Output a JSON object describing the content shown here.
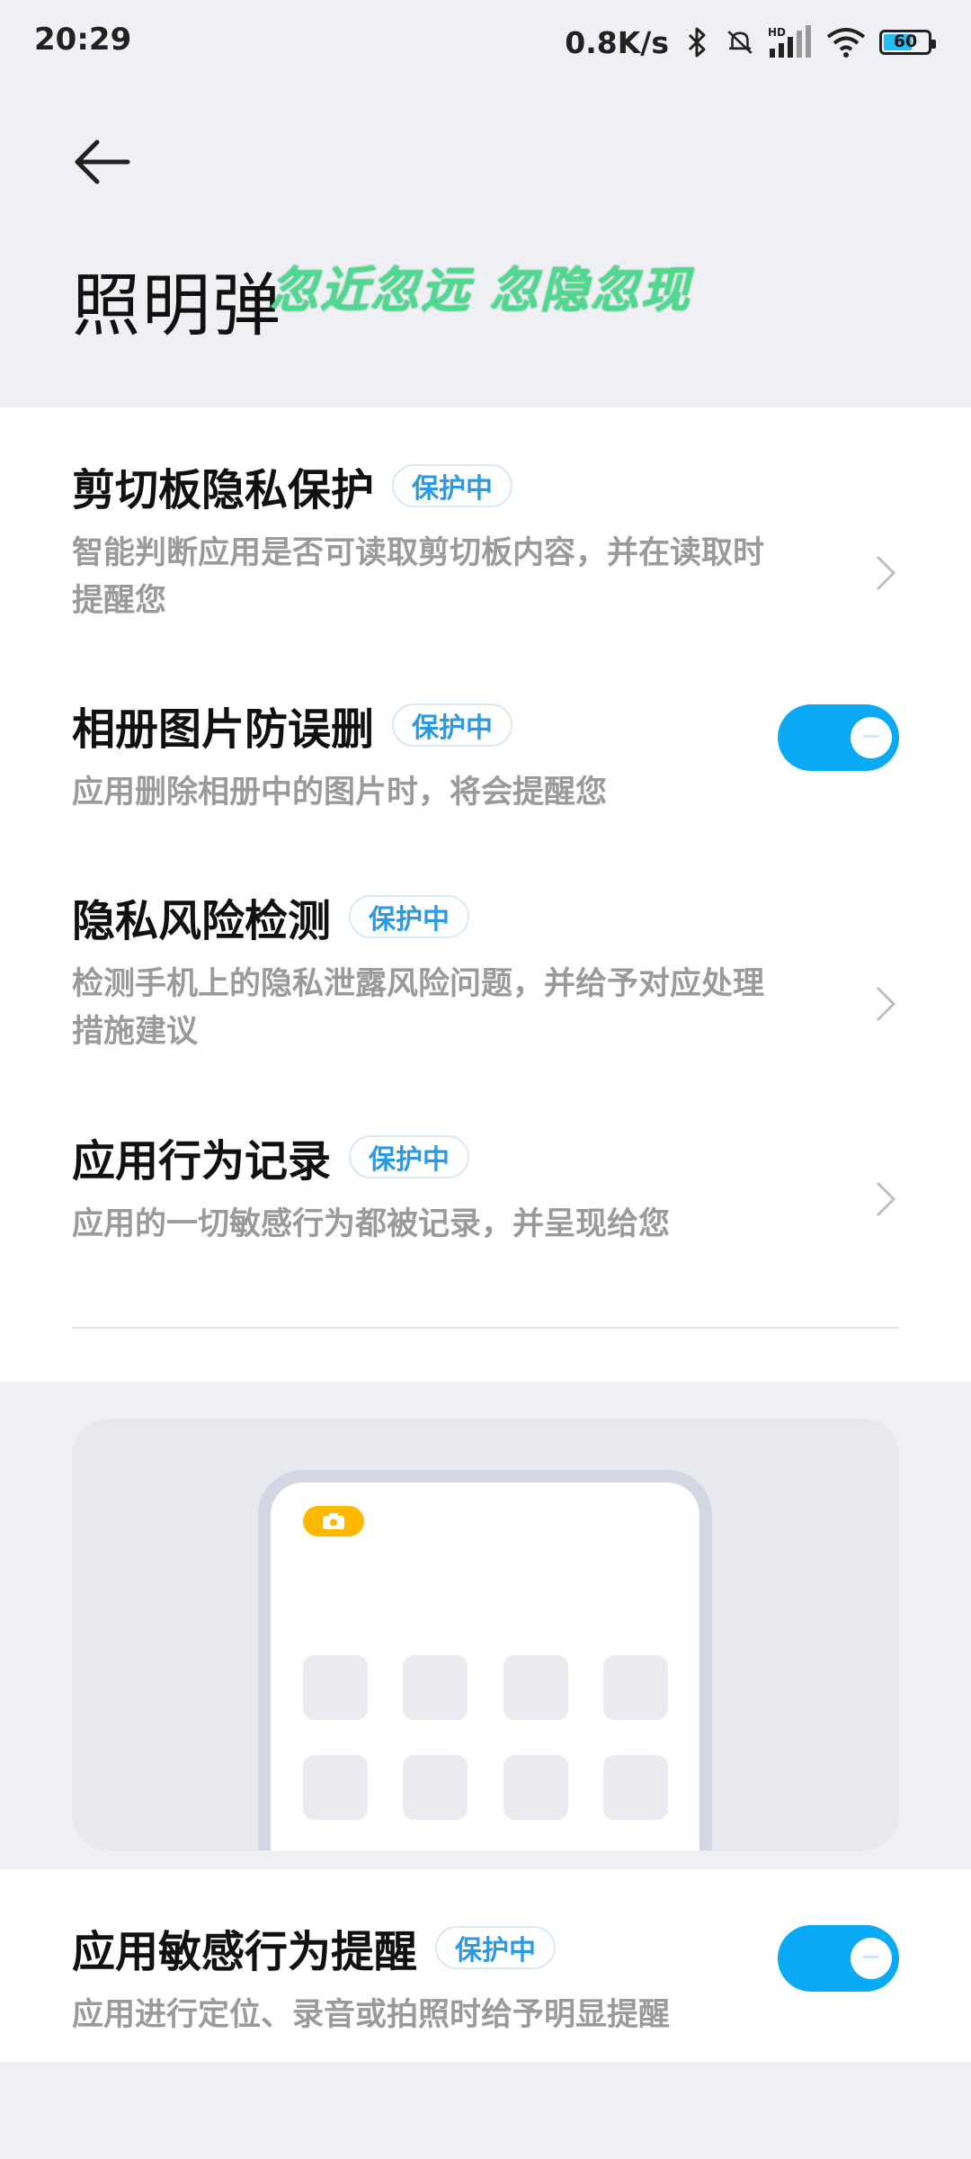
{
  "status_bar": {
    "time": "20:29",
    "net_speed": "0.8K/s",
    "battery_level": "60",
    "icons": [
      "bluetooth-icon",
      "mute-icon",
      "hd-signal-icon",
      "wifi-icon",
      "battery-icon"
    ]
  },
  "header": {
    "back_icon": "arrow-left-icon",
    "title": "照明弹",
    "danmaku_overlay": "忽近忽远 忽隐忽现"
  },
  "items": [
    {
      "title": "剪切板隐私保护",
      "badge": "保护中",
      "desc": "智能判断应用是否可读取剪切板内容，并在读取时提醒您",
      "control": "chevron"
    },
    {
      "title": "相册图片防误删",
      "badge": "保护中",
      "desc": "应用删除相册中的图片时，将会提醒您",
      "control": "toggle",
      "enabled": true
    },
    {
      "title": "隐私风险检测",
      "badge": "保护中",
      "desc": "检测手机上的隐私泄露风险问题，并给予对应处理措施建议",
      "control": "chevron"
    },
    {
      "title": "应用行为记录",
      "badge": "保护中",
      "desc": "应用的一切敏感行为都被记录，并呈现给您",
      "control": "chevron"
    }
  ],
  "illustration": {
    "camera_indicator_icon": "camera-icon",
    "accent_color": "#ffb800"
  },
  "bottom_item": {
    "title": "应用敏感行为提醒",
    "badge": "保护中",
    "desc": "应用进行定位、录音或拍照时给予明显提醒",
    "control": "toggle",
    "enabled": true
  },
  "colors": {
    "toggle_on": "#0aa9f5",
    "badge_text": "#2b9ae6",
    "page_bg": "#eef0f3"
  }
}
